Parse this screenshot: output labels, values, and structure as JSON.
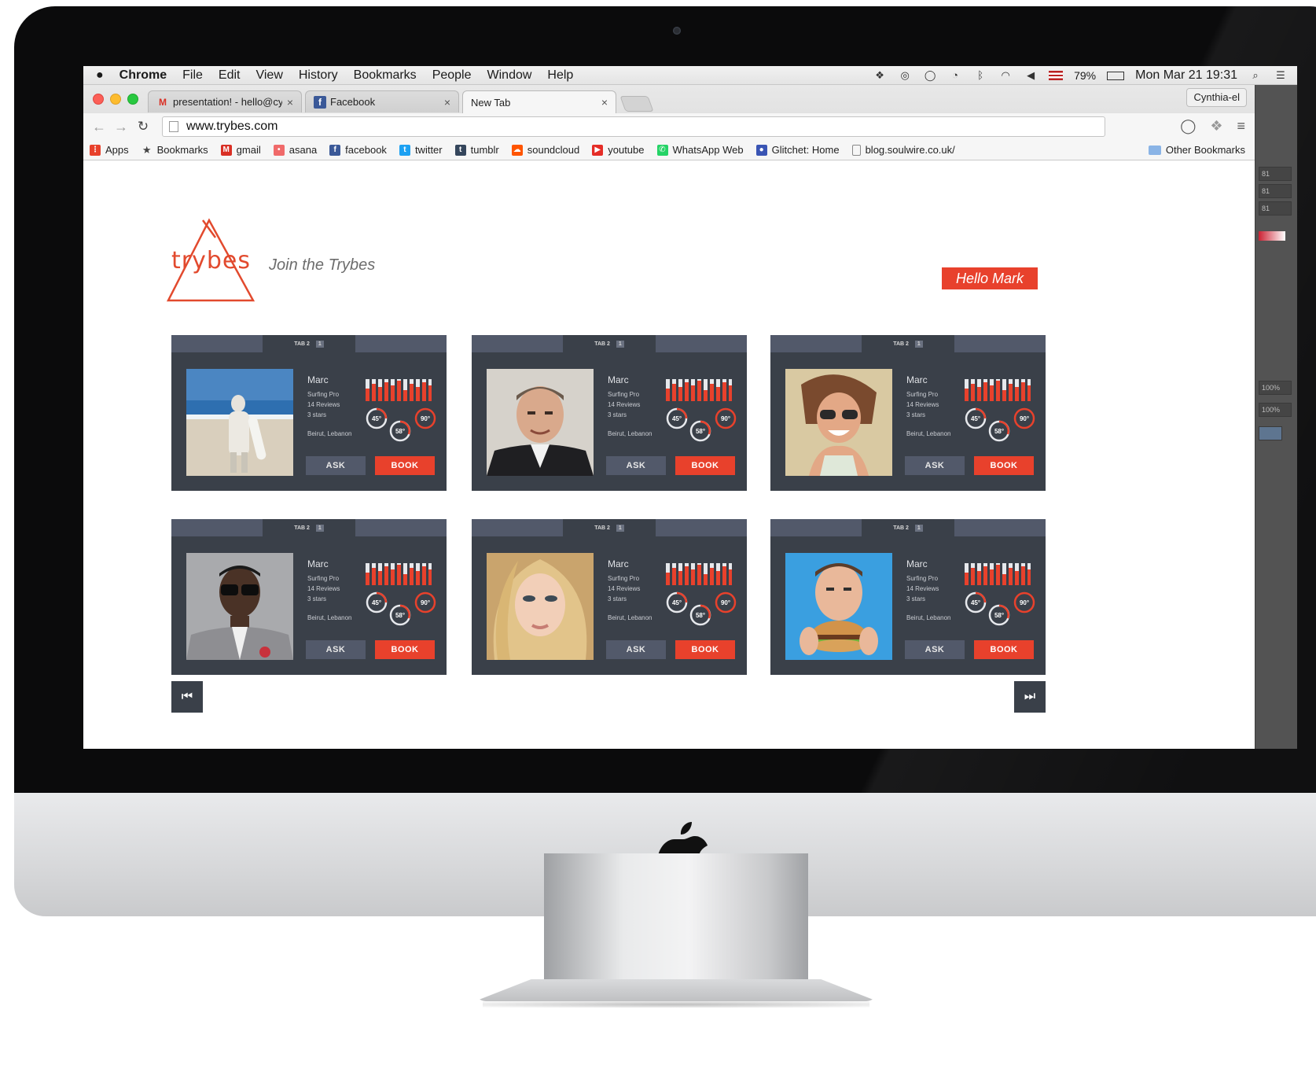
{
  "menubar": {
    "apple": "",
    "items": [
      "Chrome",
      "File",
      "Edit",
      "View",
      "History",
      "Bookmarks",
      "People",
      "Window",
      "Help"
    ],
    "battery": "79%",
    "clock": "Mon Mar 21  19:31"
  },
  "browser": {
    "tabs": [
      {
        "label": "presentation! - hello@cynth",
        "favicon": "gmail-icon"
      },
      {
        "label": "Facebook",
        "favicon": "facebook-icon"
      },
      {
        "label": "New Tab",
        "favicon": ""
      }
    ],
    "profile": "Cynthia-el",
    "url": "www.trybes.com",
    "bookmarks": [
      {
        "label": "Apps",
        "icon": "apps-grid-icon",
        "color": "#e8412c"
      },
      {
        "label": "Bookmarks",
        "icon": "star-icon",
        "color": "#444444"
      },
      {
        "label": "gmail",
        "icon": "gmail-icon",
        "color": "#d93025"
      },
      {
        "label": "asana",
        "icon": "asana-icon",
        "color": "#f06a6a"
      },
      {
        "label": "facebook",
        "icon": "facebook-icon",
        "color": "#3b5998"
      },
      {
        "label": "twitter",
        "icon": "twitter-icon",
        "color": "#1da1f2"
      },
      {
        "label": "tumblr",
        "icon": "tumblr-icon",
        "color": "#35465c"
      },
      {
        "label": "soundcloud",
        "icon": "soundcloud-icon",
        "color": "#ff5500"
      },
      {
        "label": "youtube",
        "icon": "youtube-icon",
        "color": "#e52d27"
      },
      {
        "label": "WhatsApp Web",
        "icon": "whatsapp-icon",
        "color": "#25d366"
      },
      {
        "label": "Glitchet: Home",
        "icon": "glitchet-icon",
        "color": "#3a55b4"
      },
      {
        "label": "blog.soulwire.co.uk/",
        "icon": "page-icon",
        "color": "#888888"
      }
    ],
    "other_bookmarks": "Other Bookmarks"
  },
  "side_panel": {
    "values": [
      "81",
      "81",
      "81",
      "100%",
      "100%"
    ]
  },
  "site": {
    "logo_text": "trybes",
    "tagline": "Join the Trybes",
    "hello": "Hello Mark",
    "accent": "#e8412c",
    "card_bg": "#3a4049",
    "cards": [
      {
        "tab": "TAB 2",
        "tab_num": "1",
        "name": "Marc",
        "role": "Surfing Pro",
        "reviews": "14 Reviews",
        "stars": "3 stars",
        "location": "Beirut, Lebanon",
        "dials": [
          "45°",
          "58°",
          "90°"
        ],
        "ask": "ASK",
        "book": "BOOK",
        "photo": "beach-surfer"
      },
      {
        "tab": "TAB 2",
        "tab_num": "1",
        "name": "Marc",
        "role": "Surfing Pro",
        "reviews": "14 Reviews",
        "stars": "3 stars",
        "location": "Beirut, Lebanon",
        "dials": [
          "45°",
          "58°",
          "90°"
        ],
        "ask": "ASK",
        "book": "BOOK",
        "photo": "man-in-suit"
      },
      {
        "tab": "TAB 2",
        "tab_num": "1",
        "name": "Marc",
        "role": "Surfing Pro",
        "reviews": "14 Reviews",
        "stars": "3 stars",
        "location": "Beirut, Lebanon",
        "dials": [
          "45°",
          "58°",
          "90°"
        ],
        "ask": "ASK",
        "book": "BOOK",
        "photo": "woman-sunglasses"
      },
      {
        "tab": "TAB 2",
        "tab_num": "1",
        "name": "Marc",
        "role": "Surfing Pro",
        "reviews": "14 Reviews",
        "stars": "3 stars",
        "location": "Beirut, Lebanon",
        "dials": [
          "45°",
          "58°",
          "90°"
        ],
        "ask": "ASK",
        "book": "BOOK",
        "photo": "man-shades"
      },
      {
        "tab": "TAB 2",
        "tab_num": "1",
        "name": "Marc",
        "role": "Surfing Pro",
        "reviews": "14 Reviews",
        "stars": "3 stars",
        "location": "Beirut, Lebanon",
        "dials": [
          "45°",
          "58°",
          "90°"
        ],
        "ask": "ASK",
        "book": "BOOK",
        "photo": "blonde-woman"
      },
      {
        "tab": "TAB 2",
        "tab_num": "1",
        "name": "Marc",
        "role": "Surfing Pro",
        "reviews": "14 Reviews",
        "stars": "3 stars",
        "location": "Beirut, Lebanon",
        "dials": [
          "45°",
          "58°",
          "90°"
        ],
        "ask": "ASK",
        "book": "BOOK",
        "photo": "man-burger"
      }
    ],
    "pager_prev": "⏮",
    "pager_next": "⏭"
  }
}
